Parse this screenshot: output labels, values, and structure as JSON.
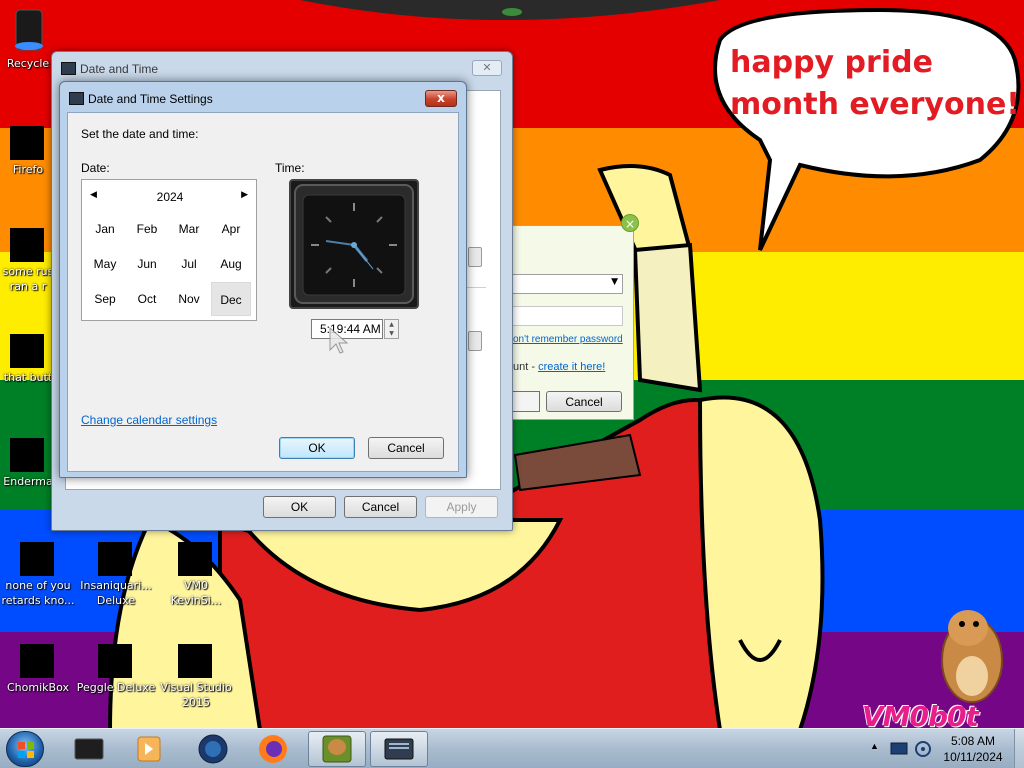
{
  "wallpaper": {
    "speech_bubble_text": "happy pride month everyone!",
    "watermark": "VM0b0t",
    "stripe_colors": [
      "#e50000",
      "#ff8c00",
      "#ffed00",
      "#008026",
      "#004dff",
      "#750787"
    ]
  },
  "desktop_icons": [
    {
      "label": "Recycle",
      "icon": "recycle-bin-icon"
    },
    {
      "label": "Firefo",
      "icon": "firefox-icon"
    },
    {
      "label": "some rus\nran a r",
      "icon": "file-icon"
    },
    {
      "label": "that butt",
      "icon": "folder-icon"
    },
    {
      "label": "Enderma",
      "icon": "app-icon"
    },
    {
      "label": "none of you\nretards kno...",
      "icon": "app-icon"
    },
    {
      "label": "Insaniquari...\nDeluxe",
      "icon": "game-icon"
    },
    {
      "label": "VM0\nKevinSi...",
      "icon": "app-icon"
    },
    {
      "label": "ChomikBox",
      "icon": "chomikbox-icon"
    },
    {
      "label": "Peggle Deluxe",
      "icon": "game-icon"
    },
    {
      "label": "Visual Studio\n2015",
      "icon": "visual-studio-icon"
    }
  ],
  "outer_window": {
    "title": "Date and Time",
    "ok_label": "OK",
    "cancel_label": "Cancel",
    "apply_label": "Apply"
  },
  "inner_window": {
    "title": "Date and Time Settings",
    "close_label": "x",
    "instruction": "Set the date and time:",
    "date_label": "Date:",
    "time_label": "Time:",
    "calendar": {
      "year": "2024",
      "prev": "◀",
      "next": "▶",
      "months": [
        "Jan",
        "Feb",
        "Mar",
        "Apr",
        "May",
        "Jun",
        "Jul",
        "Aug",
        "Sep",
        "Oct",
        "Nov",
        "Dec"
      ],
      "selected_month": "Dec"
    },
    "time_value": "5:19:44 AM",
    "change_calendar_link": "Change calendar settings",
    "ok_label": "OK",
    "cancel_label": "Cancel"
  },
  "background_dialog": {
    "forgot_password_link": "on't remember password",
    "no_account_text": "unt - ",
    "create_link": "create it here!",
    "cancel_label": "Cancel"
  },
  "taskbar": {
    "clock_time": "5:08 AM",
    "clock_date": "10/11/2024",
    "tray_arrow": "▲"
  }
}
